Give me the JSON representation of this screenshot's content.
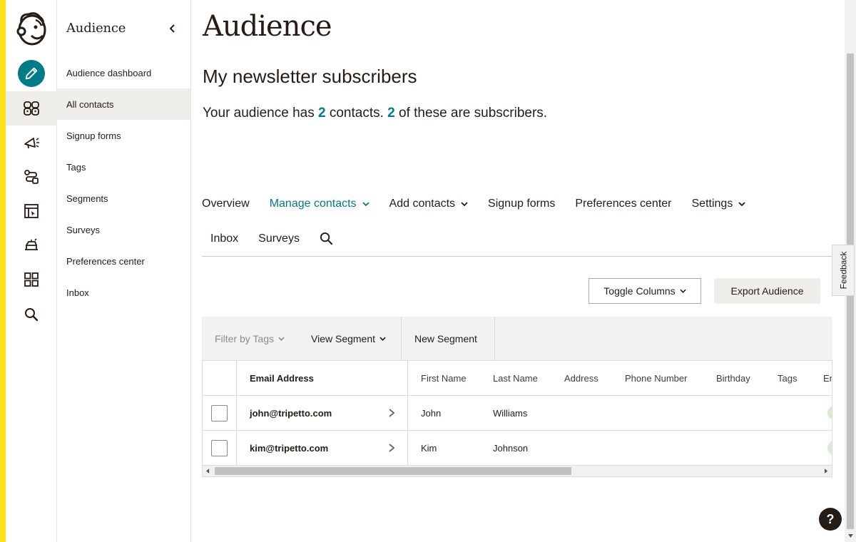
{
  "colors": {
    "brand_yellow": "#ffe01b",
    "accent_teal": "#007c89",
    "active_bg": "#efeeea",
    "text_dark": "#241c15"
  },
  "rail": {
    "logo_icon": "mailchimp-freddie-logo-icon",
    "items": [
      {
        "icon": "pencil-create-icon"
      },
      {
        "icon": "audience-icon",
        "active": true
      },
      {
        "icon": "campaigns-megaphone-icon"
      },
      {
        "icon": "automations-icon"
      },
      {
        "icon": "website-icon"
      },
      {
        "icon": "content-studio-icon"
      },
      {
        "icon": "integrations-grid-icon"
      },
      {
        "icon": "search-icon"
      }
    ]
  },
  "subnav": {
    "title": "Audience",
    "items": [
      {
        "label": "Audience dashboard"
      },
      {
        "label": "All contacts",
        "active": true
      },
      {
        "label": "Signup forms"
      },
      {
        "label": "Tags"
      },
      {
        "label": "Segments"
      },
      {
        "label": "Surveys"
      },
      {
        "label": "Preferences center"
      },
      {
        "label": "Inbox"
      }
    ]
  },
  "main": {
    "title": "Audience",
    "audience_name": "My newsletter subscribers",
    "summary": {
      "part1": "Your audience has ",
      "contacts": "2",
      "part2": " contacts. ",
      "subscribers": "2",
      "part3": " of these are subscribers."
    },
    "tabs": [
      {
        "label": "Overview"
      },
      {
        "label": "Manage contacts",
        "dropdown": true,
        "active": true
      },
      {
        "label": "Add contacts",
        "dropdown": true
      },
      {
        "label": "Signup forms"
      },
      {
        "label": "Preferences center"
      },
      {
        "label": "Settings",
        "dropdown": true
      },
      {
        "label": "Inbox"
      },
      {
        "label": "Surveys"
      }
    ],
    "toggle_columns_label": "Toggle Columns",
    "export_label": "Export Audience",
    "filter_tags_label": "Filter by Tags",
    "view_segment_label": "View Segment",
    "new_segment_label": "New Segment",
    "table": {
      "headers": [
        "Email Address",
        "First Name",
        "Last Name",
        "Address",
        "Phone Number",
        "Birthday",
        "Tags",
        "En"
      ],
      "rows": [
        {
          "email": "john@tripetto.com",
          "first": "John",
          "last": "Williams"
        },
        {
          "email": "kim@tripetto.com",
          "first": "Kim",
          "last": "Johnson"
        }
      ]
    }
  },
  "feedback_label": "Feedback",
  "help_label": "?"
}
